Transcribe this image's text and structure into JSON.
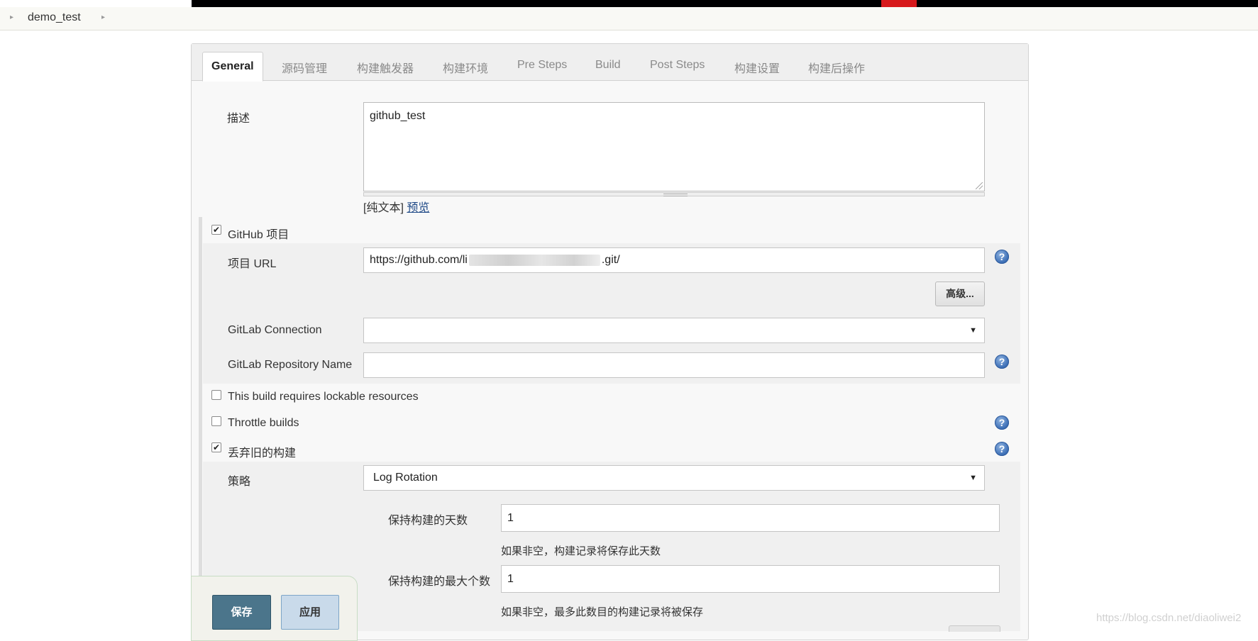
{
  "breadcrumb": {
    "item": "demo_test"
  },
  "tabs": [
    {
      "label": "General",
      "active": true
    },
    {
      "label": "源码管理"
    },
    {
      "label": "构建触发器"
    },
    {
      "label": "构建环境"
    },
    {
      "label": "Pre Steps"
    },
    {
      "label": "Build"
    },
    {
      "label": "Post Steps"
    },
    {
      "label": "构建设置"
    },
    {
      "label": "构建后操作"
    }
  ],
  "description": {
    "label": "描述",
    "value": "github_test",
    "plain_text": "[纯文本]",
    "preview": "预览"
  },
  "github_project": {
    "label": "GitHub 项目",
    "checked": true,
    "url_label": "项目 URL",
    "url_prefix": "https://github.com/li",
    "url_suffix": ".git/",
    "advanced_button": "高级..."
  },
  "gitlab": {
    "connection_label": "GitLab Connection",
    "connection_value": "",
    "repo_label": "GitLab Repository Name",
    "repo_value": ""
  },
  "options": {
    "lockable_label": "This build requires lockable resources",
    "lockable_checked": false,
    "throttle_label": "Throttle builds",
    "throttle_checked": false,
    "discard_label": "丢弃旧的构建",
    "discard_checked": true
  },
  "strategy": {
    "label": "策略",
    "value": "Log Rotation",
    "days_label": "保持构建的天数",
    "days_value": "1",
    "days_hint": "如果非空，构建记录将保存此天数",
    "max_label": "保持构建的最大个数",
    "max_value": "1",
    "max_hint": "如果非空，最多此数目的构建记录将被保存"
  },
  "buttons": {
    "save": "保存",
    "apply": "应用"
  },
  "watermark": "https://blog.csdn.net/diaoliwei2",
  "help_glyph": "?",
  "colors": {
    "save": "#4b758b",
    "apply": "#c9daea",
    "help": "#3d6fb6",
    "topbar_red": "#d7191b"
  }
}
